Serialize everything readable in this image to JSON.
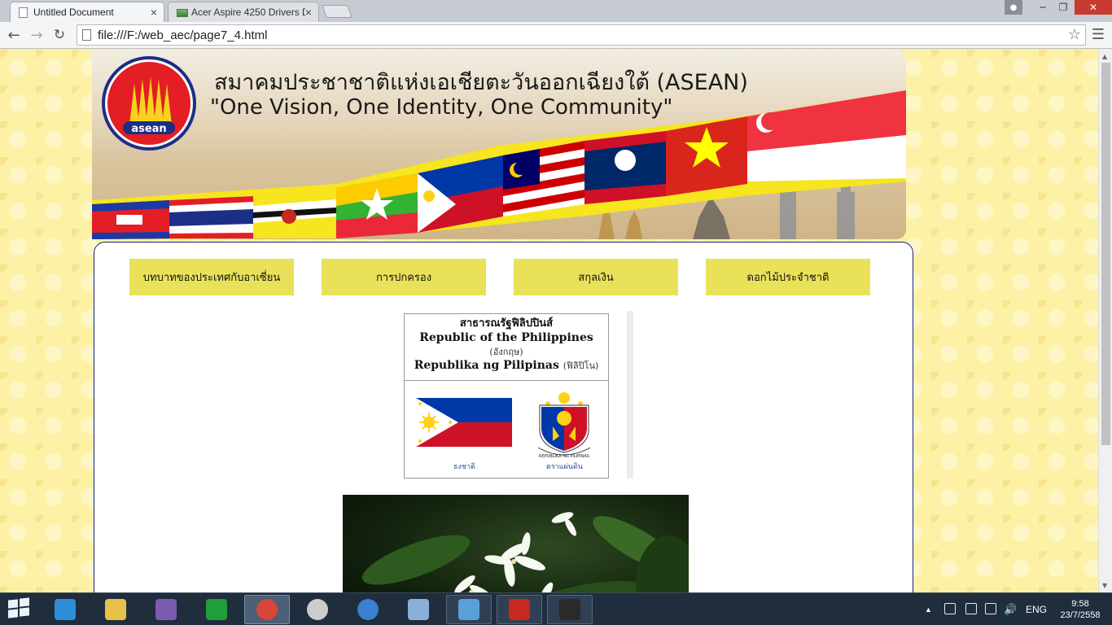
{
  "browser": {
    "tabs": [
      {
        "title": "Untitled Document",
        "active": true
      },
      {
        "title": "Acer Aspire 4250 Drivers D",
        "active": false
      }
    ],
    "tab_close_glyph": "×",
    "url": "file:///F:/web_aec/page7_4.html"
  },
  "banner": {
    "logo_text": "asean",
    "title_th": "สมาคมประชาชาติแห่งเอเชียตะวันออกเฉียงใต้ (ASEAN)",
    "motto": "\"One Vision, One Identity, One Community\""
  },
  "nav": {
    "items": [
      {
        "label": "บทบาทของประเทศกับอาเซี่ยน"
      },
      {
        "label": "การปกครอง"
      },
      {
        "label": "สกุลเงิน"
      },
      {
        "label": "ดอกไม้ประจำชาติ"
      }
    ]
  },
  "infobox": {
    "name_th": "สาธารณรัฐฟิลิปปินส์",
    "name_en": "Republic of the Philippines",
    "en_note": "(อังกฤษ)",
    "name_fil": "Republika ng Pilipinas",
    "fil_note": "(ฟิลิปิโน)",
    "flag_caption": "ธงชาติ",
    "seal_caption": "ตราแผ่นดิน",
    "seal_text": "REPUBLIKA NG PILIPINAS"
  },
  "taskbar": {
    "apps": [
      {
        "icon": "internet-explorer-icon",
        "color": "#2c8fd8"
      },
      {
        "icon": "file-explorer-icon",
        "color": "#e7c24a"
      },
      {
        "icon": "visual-studio-icon",
        "color": "#7b5bb0"
      },
      {
        "icon": "store-icon",
        "color": "#1f9e3a"
      },
      {
        "icon": "chrome-icon",
        "color": "#d8463a",
        "active": true
      },
      {
        "icon": "safari-compass-icon",
        "color": "#cccccc"
      },
      {
        "icon": "sphere-app-icon",
        "color": "#3a7fd0"
      },
      {
        "icon": "photo-viewer-icon",
        "color": "#8ab0d8"
      },
      {
        "icon": "paint-icon",
        "color": "#5aa0d8",
        "open": true
      },
      {
        "icon": "red-app-icon",
        "color": "#c8281e",
        "open": true
      },
      {
        "icon": "hon-game-icon",
        "color": "#2a2a2a",
        "open": true
      }
    ],
    "language": "ENG",
    "time": "9:58",
    "date": "23/7/2558"
  },
  "colors": {
    "menu_button": "#e9e15a",
    "page_background": "#fdf1a6",
    "panel_border": "#1a237e",
    "caption_blue": "#2b4c9b"
  }
}
